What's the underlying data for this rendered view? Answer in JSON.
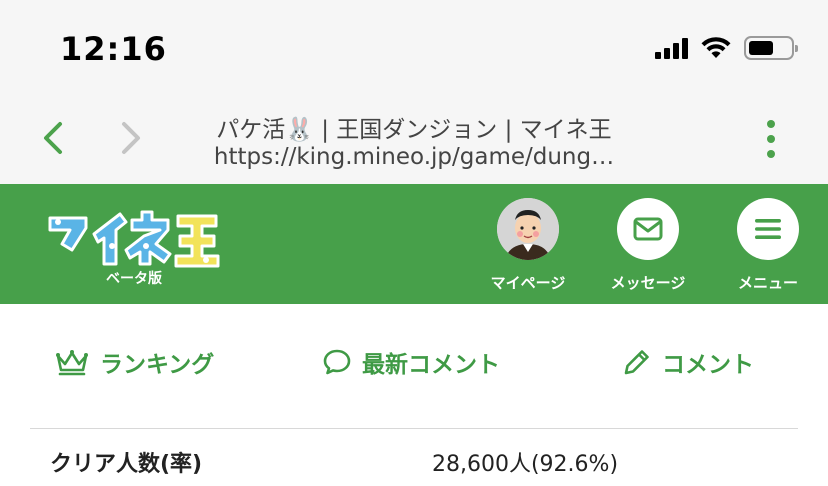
{
  "status_bar": {
    "time": "12:16"
  },
  "browser": {
    "page_title": "パケ活🐰 | 王国ダンジョン | マイネ王",
    "url": "https://king.mineo.jp/game/dung…"
  },
  "header": {
    "logo_text": "マイネ王",
    "beta_label": "ベータ版",
    "buttons": [
      {
        "label": "マイページ"
      },
      {
        "label": "メッセージ"
      },
      {
        "label": "メニュー"
      }
    ]
  },
  "tabs": [
    {
      "label": "ランキング"
    },
    {
      "label": "最新コメント"
    },
    {
      "label": "コメント"
    }
  ],
  "stats": {
    "clear_label": "クリア人数(率)",
    "clear_value": "28,600人(92.6%)"
  },
  "colors": {
    "brand_green": "#47a04a",
    "accent_green": "#3f9a45"
  }
}
